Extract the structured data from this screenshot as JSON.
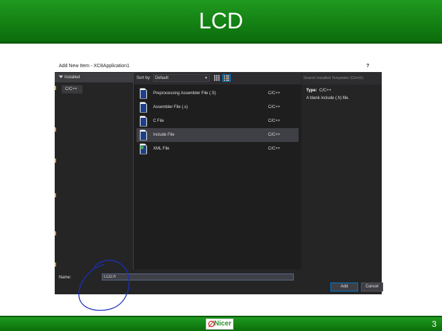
{
  "slide": {
    "title": "LCD",
    "page_number": "3",
    "footer_logo_text": "Nicer",
    "header_color": "#178a17",
    "footer_color": "#178a17"
  },
  "dialog": {
    "title": "Add New Item - XC8Application1",
    "help_label": "?",
    "left_pane": {
      "header": "Installed",
      "tree_items": [
        "C/C++"
      ]
    },
    "sort": {
      "label": "Sort by:",
      "selected": "Default"
    },
    "search": {
      "placeholder": "Search Installed Templates (Ctrl+E)"
    },
    "items": [
      {
        "name": "Preprocessing Assembler File (.S)",
        "type": "C/C++",
        "icon": "file-icon",
        "selected": false
      },
      {
        "name": "Assembler File (.s)",
        "type": "C/C++",
        "icon": "file-icon",
        "selected": false
      },
      {
        "name": "C File",
        "type": "C/C++",
        "icon": "file-icon",
        "selected": false
      },
      {
        "name": "Include File",
        "type": "C/C++",
        "icon": "file-icon",
        "selected": true
      },
      {
        "name": "XML File",
        "type": "C/C++",
        "icon": "xml-file-icon",
        "selected": false
      }
    ],
    "details": {
      "type_label": "Type:",
      "type_value": "C/C++",
      "description": "A blank include (.h) file."
    },
    "name_field": {
      "label": "Name:",
      "value": "LCD.h"
    },
    "buttons": {
      "add": "Add",
      "cancel": "Cancel"
    },
    "colors": {
      "background": "#252526",
      "selection": "#3f3f46",
      "accent": "#007acc",
      "annotation": "#1a2fc0"
    }
  }
}
